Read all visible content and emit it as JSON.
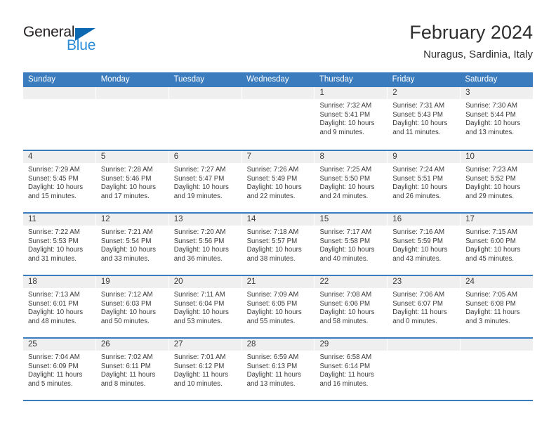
{
  "brand": {
    "name_dark": "General",
    "name_blue": "Blue",
    "accent_color": "#0c68b0",
    "blue_text_color": "#2b8cd9"
  },
  "header": {
    "title": "February 2024",
    "subtitle": "Nuragus, Sardinia, Italy"
  },
  "theme": {
    "header_band": "#3b7cbe",
    "day_strip": "#efefef",
    "text": "#3a3a3a"
  },
  "weekdays": [
    "Sunday",
    "Monday",
    "Tuesday",
    "Wednesday",
    "Thursday",
    "Friday",
    "Saturday"
  ],
  "weeks": [
    [
      {
        "day": "",
        "lines": []
      },
      {
        "day": "",
        "lines": []
      },
      {
        "day": "",
        "lines": []
      },
      {
        "day": "",
        "lines": []
      },
      {
        "day": "1",
        "lines": [
          "Sunrise: 7:32 AM",
          "Sunset: 5:41 PM",
          "Daylight: 10 hours",
          "and 9 minutes."
        ]
      },
      {
        "day": "2",
        "lines": [
          "Sunrise: 7:31 AM",
          "Sunset: 5:43 PM",
          "Daylight: 10 hours",
          "and 11 minutes."
        ]
      },
      {
        "day": "3",
        "lines": [
          "Sunrise: 7:30 AM",
          "Sunset: 5:44 PM",
          "Daylight: 10 hours",
          "and 13 minutes."
        ]
      }
    ],
    [
      {
        "day": "4",
        "lines": [
          "Sunrise: 7:29 AM",
          "Sunset: 5:45 PM",
          "Daylight: 10 hours",
          "and 15 minutes."
        ]
      },
      {
        "day": "5",
        "lines": [
          "Sunrise: 7:28 AM",
          "Sunset: 5:46 PM",
          "Daylight: 10 hours",
          "and 17 minutes."
        ]
      },
      {
        "day": "6",
        "lines": [
          "Sunrise: 7:27 AM",
          "Sunset: 5:47 PM",
          "Daylight: 10 hours",
          "and 19 minutes."
        ]
      },
      {
        "day": "7",
        "lines": [
          "Sunrise: 7:26 AM",
          "Sunset: 5:49 PM",
          "Daylight: 10 hours",
          "and 22 minutes."
        ]
      },
      {
        "day": "8",
        "lines": [
          "Sunrise: 7:25 AM",
          "Sunset: 5:50 PM",
          "Daylight: 10 hours",
          "and 24 minutes."
        ]
      },
      {
        "day": "9",
        "lines": [
          "Sunrise: 7:24 AM",
          "Sunset: 5:51 PM",
          "Daylight: 10 hours",
          "and 26 minutes."
        ]
      },
      {
        "day": "10",
        "lines": [
          "Sunrise: 7:23 AM",
          "Sunset: 5:52 PM",
          "Daylight: 10 hours",
          "and 29 minutes."
        ]
      }
    ],
    [
      {
        "day": "11",
        "lines": [
          "Sunrise: 7:22 AM",
          "Sunset: 5:53 PM",
          "Daylight: 10 hours",
          "and 31 minutes."
        ]
      },
      {
        "day": "12",
        "lines": [
          "Sunrise: 7:21 AM",
          "Sunset: 5:54 PM",
          "Daylight: 10 hours",
          "and 33 minutes."
        ]
      },
      {
        "day": "13",
        "lines": [
          "Sunrise: 7:20 AM",
          "Sunset: 5:56 PM",
          "Daylight: 10 hours",
          "and 36 minutes."
        ]
      },
      {
        "day": "14",
        "lines": [
          "Sunrise: 7:18 AM",
          "Sunset: 5:57 PM",
          "Daylight: 10 hours",
          "and 38 minutes."
        ]
      },
      {
        "day": "15",
        "lines": [
          "Sunrise: 7:17 AM",
          "Sunset: 5:58 PM",
          "Daylight: 10 hours",
          "and 40 minutes."
        ]
      },
      {
        "day": "16",
        "lines": [
          "Sunrise: 7:16 AM",
          "Sunset: 5:59 PM",
          "Daylight: 10 hours",
          "and 43 minutes."
        ]
      },
      {
        "day": "17",
        "lines": [
          "Sunrise: 7:15 AM",
          "Sunset: 6:00 PM",
          "Daylight: 10 hours",
          "and 45 minutes."
        ]
      }
    ],
    [
      {
        "day": "18",
        "lines": [
          "Sunrise: 7:13 AM",
          "Sunset: 6:01 PM",
          "Daylight: 10 hours",
          "and 48 minutes."
        ]
      },
      {
        "day": "19",
        "lines": [
          "Sunrise: 7:12 AM",
          "Sunset: 6:03 PM",
          "Daylight: 10 hours",
          "and 50 minutes."
        ]
      },
      {
        "day": "20",
        "lines": [
          "Sunrise: 7:11 AM",
          "Sunset: 6:04 PM",
          "Daylight: 10 hours",
          "and 53 minutes."
        ]
      },
      {
        "day": "21",
        "lines": [
          "Sunrise: 7:09 AM",
          "Sunset: 6:05 PM",
          "Daylight: 10 hours",
          "and 55 minutes."
        ]
      },
      {
        "day": "22",
        "lines": [
          "Sunrise: 7:08 AM",
          "Sunset: 6:06 PM",
          "Daylight: 10 hours",
          "and 58 minutes."
        ]
      },
      {
        "day": "23",
        "lines": [
          "Sunrise: 7:06 AM",
          "Sunset: 6:07 PM",
          "Daylight: 11 hours",
          "and 0 minutes."
        ]
      },
      {
        "day": "24",
        "lines": [
          "Sunrise: 7:05 AM",
          "Sunset: 6:08 PM",
          "Daylight: 11 hours",
          "and 3 minutes."
        ]
      }
    ],
    [
      {
        "day": "25",
        "lines": [
          "Sunrise: 7:04 AM",
          "Sunset: 6:09 PM",
          "Daylight: 11 hours",
          "and 5 minutes."
        ]
      },
      {
        "day": "26",
        "lines": [
          "Sunrise: 7:02 AM",
          "Sunset: 6:11 PM",
          "Daylight: 11 hours",
          "and 8 minutes."
        ]
      },
      {
        "day": "27",
        "lines": [
          "Sunrise: 7:01 AM",
          "Sunset: 6:12 PM",
          "Daylight: 11 hours",
          "and 10 minutes."
        ]
      },
      {
        "day": "28",
        "lines": [
          "Sunrise: 6:59 AM",
          "Sunset: 6:13 PM",
          "Daylight: 11 hours",
          "and 13 minutes."
        ]
      },
      {
        "day": "29",
        "lines": [
          "Sunrise: 6:58 AM",
          "Sunset: 6:14 PM",
          "Daylight: 11 hours",
          "and 16 minutes."
        ]
      },
      {
        "day": "",
        "lines": []
      },
      {
        "day": "",
        "lines": []
      }
    ]
  ]
}
